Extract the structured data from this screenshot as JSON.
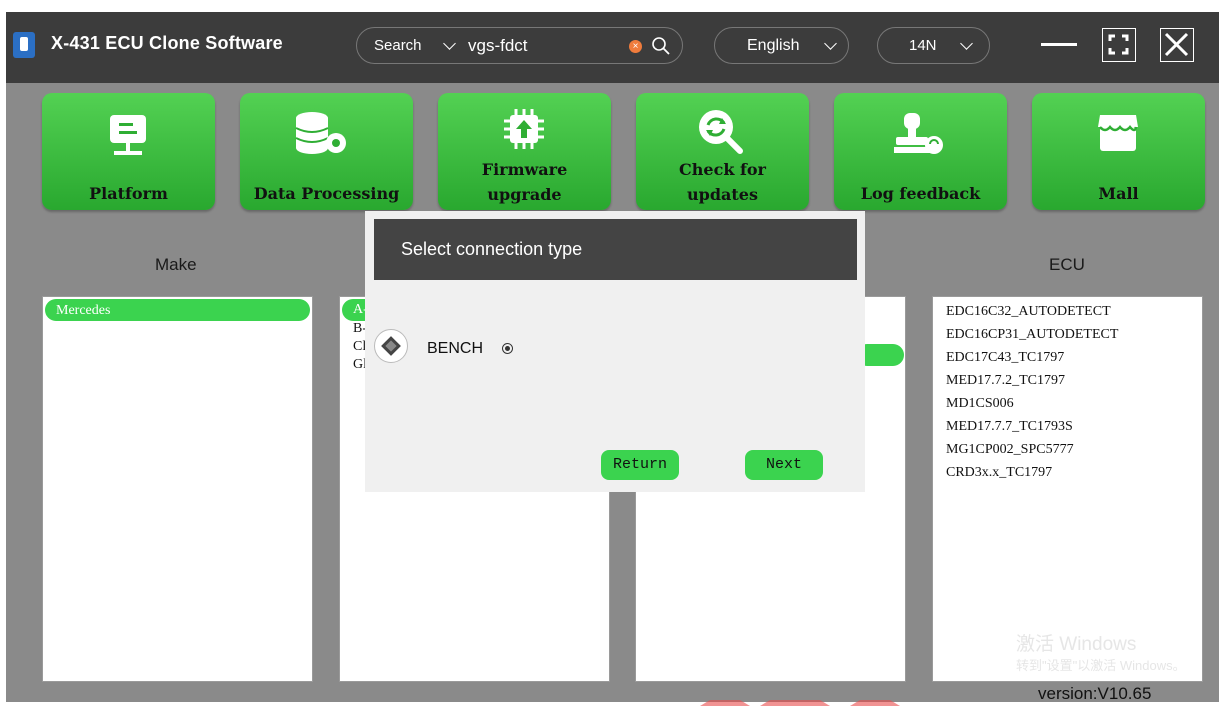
{
  "titlebar": {
    "title": "X-431 ECU Clone Software",
    "search_label": "Search",
    "search_value": "vgs-fdct",
    "language": "English",
    "region": "14N"
  },
  "tiles": [
    {
      "label": "Platform",
      "icon": "monitor-icon"
    },
    {
      "label": "Data Processing",
      "icon": "database-gear-icon"
    },
    {
      "label": "Firmware upgrade",
      "icon": "chip-upload-icon"
    },
    {
      "label": "Check for updates",
      "icon": "refresh-search-icon"
    },
    {
      "label": "Log feedback",
      "icon": "stamp-icon"
    },
    {
      "label": "Mall",
      "icon": "store-icon"
    }
  ],
  "columns": {
    "make_title": "Make",
    "ecu_title": "ECU"
  },
  "make_list": [
    "Mercedes"
  ],
  "model_list_visible": [
    "A-",
    "B-",
    "Cl",
    "Gl"
  ],
  "ecu_list": [
    "EDC16C32_AUTODETECT",
    "EDC16CP31_AUTODETECT",
    "EDC17C43_TC1797",
    "MED17.7.2_TC1797",
    "MD1CS006",
    "MED17.7.7_TC1793S",
    "MG1CP002_SPC5777",
    "CRD3x.x_TC1797"
  ],
  "modal": {
    "title": "Select connection type",
    "option": "BENCH",
    "return_label": "Return",
    "next_label": "Next"
  },
  "watermark": {
    "line1": "激活 Windows",
    "line2": "转到\"设置\"以激活 Windows。"
  },
  "version": "version:V10.65",
  "colors": {
    "accent_green": "#3bd34f",
    "titlebar": "#3c3c3c",
    "background": "#8a8a8a"
  }
}
